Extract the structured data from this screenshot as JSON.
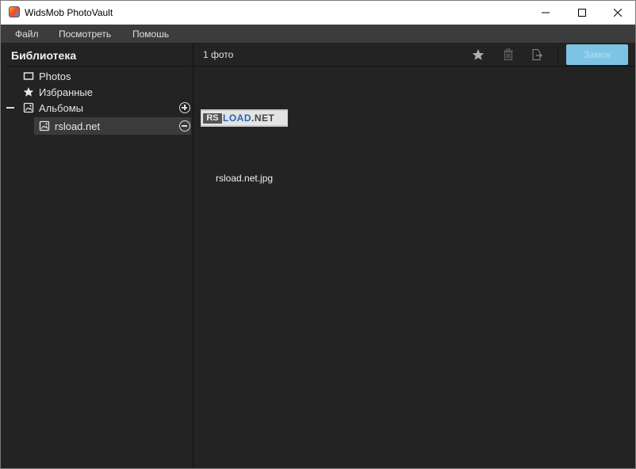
{
  "window": {
    "title": "WidsMob PhotoVault"
  },
  "menu": {
    "items": [
      "Файл",
      "Посмотреть",
      "Помошь"
    ]
  },
  "sidebar": {
    "title": "Библиотека",
    "items": [
      {
        "label": "Photos",
        "icon": "photo-frame-icon"
      },
      {
        "label": "Избранные",
        "icon": "star-icon"
      },
      {
        "label": "Альбомы",
        "icon": "album-icon"
      },
      {
        "label": "rsload.net",
        "icon": "album-icon",
        "selected": true
      }
    ]
  },
  "toolbar": {
    "photo_count": "1 фото",
    "lock_label": "Замок",
    "icons": [
      "star-icon",
      "trash-icon",
      "export-icon"
    ]
  },
  "content": {
    "thumbnail": {
      "logo_left": "RS",
      "logo_mid": "LOAD",
      "logo_right": ".NET"
    },
    "file_name": "rsload.net.jpg"
  },
  "colors": {
    "accent": "#7dc4e4",
    "background": "#232323",
    "menubar": "#3c3c3c"
  }
}
